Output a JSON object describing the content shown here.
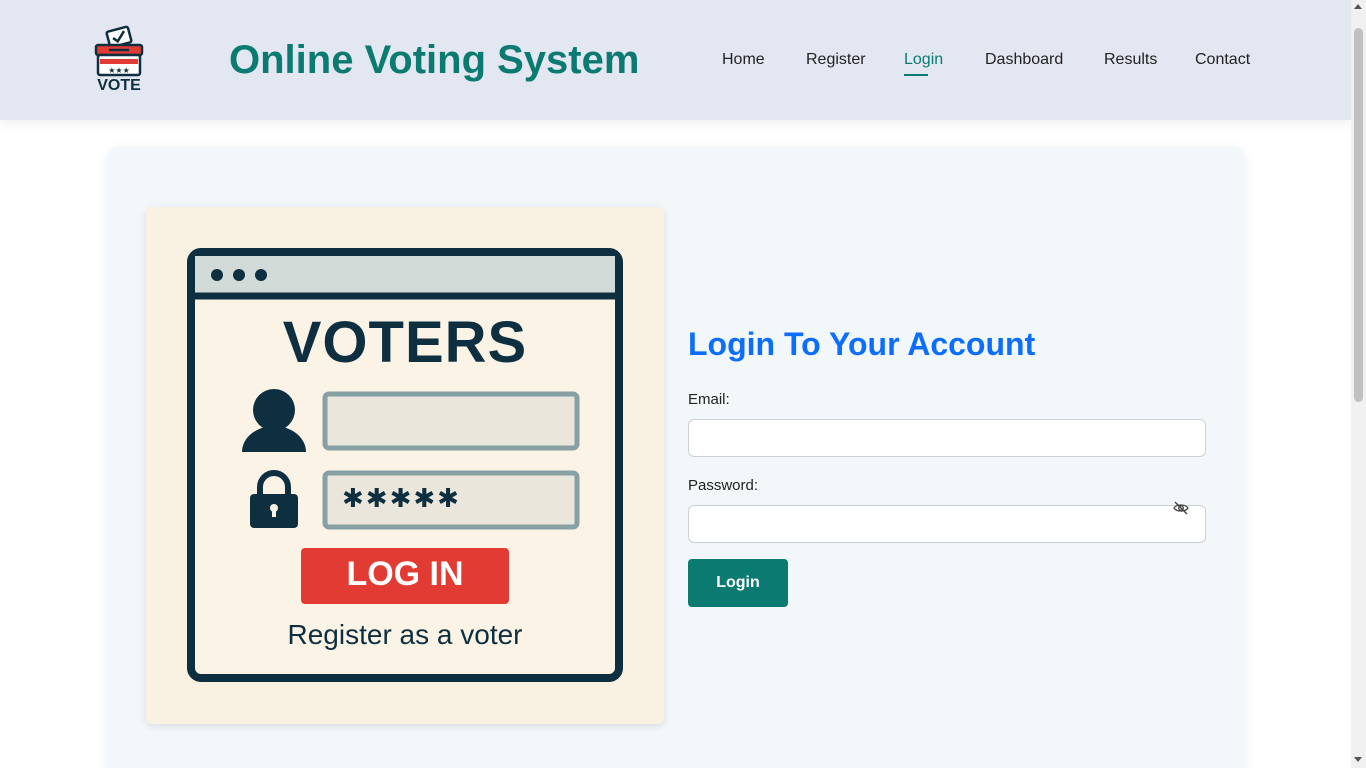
{
  "header": {
    "logo_text": "VOTE",
    "title": "Online Voting System",
    "nav": [
      "Home",
      "Register",
      "Login",
      "Dashboard",
      "Results",
      "Contact"
    ],
    "active_nav": "Login"
  },
  "illustration": {
    "heading": "VOTERS",
    "password_mask": "✱✱✱✱✱",
    "button_text": "LOG IN",
    "caption": "Register as a voter"
  },
  "form": {
    "title": "Login To Your Account",
    "email_label": "Email:",
    "email_value": "",
    "password_label": "Password:",
    "password_value": "",
    "submit_label": "Login",
    "password_toggle_icon": "eye-slash-icon"
  },
  "colors": {
    "header_bg": "#e3e7f2",
    "brand_teal": "#0b7b72",
    "form_title_blue": "#0d6efd",
    "card_bg": "#f2f7fa",
    "illustration_bg": "#f9f2e3",
    "login_red": "#e23b33",
    "dark_navy": "#0e2f40"
  }
}
